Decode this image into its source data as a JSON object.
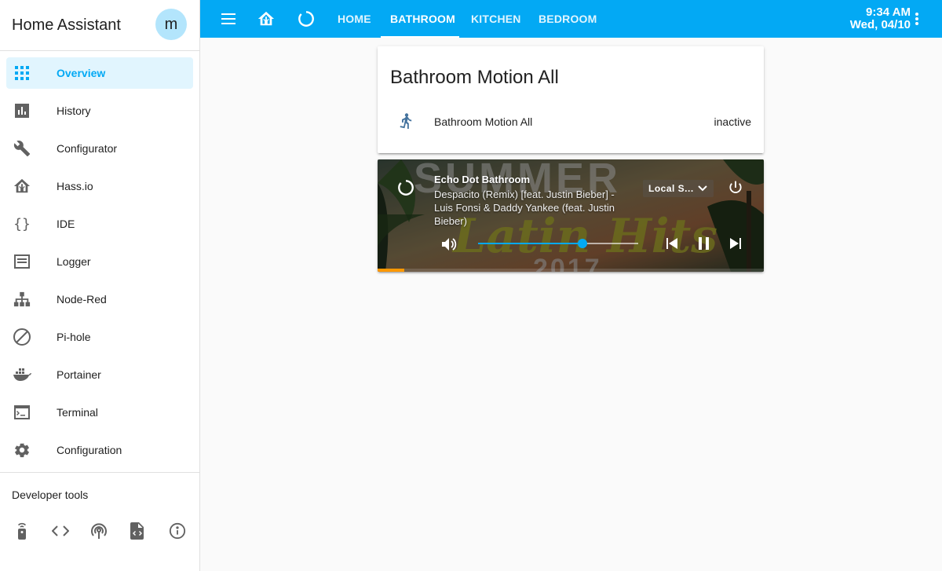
{
  "sidebar": {
    "title": "Home Assistant",
    "avatar_letter": "m",
    "items": [
      {
        "label": "Overview",
        "icon": "grid-icon",
        "active": true
      },
      {
        "label": "History",
        "icon": "bar-chart-icon"
      },
      {
        "label": "Configurator",
        "icon": "wrench-icon"
      },
      {
        "label": "Hass.io",
        "icon": "hassio-icon"
      },
      {
        "label": "IDE",
        "icon": "braces-icon"
      },
      {
        "label": "Logger",
        "icon": "message-text-icon"
      },
      {
        "label": "Node-Red",
        "icon": "sitemap-icon"
      },
      {
        "label": "Pi-hole",
        "icon": "block-icon"
      },
      {
        "label": "Portainer",
        "icon": "docker-icon"
      },
      {
        "label": "Terminal",
        "icon": "console-icon"
      },
      {
        "label": "Configuration",
        "icon": "settings-icon"
      }
    ],
    "developer_tools_label": "Developer tools",
    "developer_tools": [
      "remote-icon",
      "code-tags-icon",
      "access-point-icon",
      "file-xml-icon",
      "info-icon"
    ]
  },
  "toolbar": {
    "tabs": [
      {
        "label": "HOME",
        "active": false
      },
      {
        "label": "BATHROOM",
        "active": true
      },
      {
        "label": "KITCHEN",
        "active": false
      },
      {
        "label": "BEDROOM",
        "active": false
      }
    ],
    "time": "9:34 AM",
    "date": "Wed, 04/10",
    "accent_color": "#03a9f4"
  },
  "entities_card": {
    "title": "Bathroom Motion All",
    "rows": [
      {
        "name": "Bathroom Motion All",
        "state": "inactive",
        "icon": "walk-icon"
      }
    ]
  },
  "media_card": {
    "player_name": "Echo Dot Bathroom",
    "track": "Despacito (Remix) [feat. Justin Bieber] - Luis Fonsi & Daddy Yankee (feat. Justin Bieber)",
    "source": "Local S...",
    "volume_fraction": 0.65,
    "progress_fraction": 0.07,
    "artwork_text_top": "SUMMER",
    "artwork_text_script": "Latin Hits",
    "artwork_text_bottom": "2017",
    "progress_color": "#ff9800"
  }
}
